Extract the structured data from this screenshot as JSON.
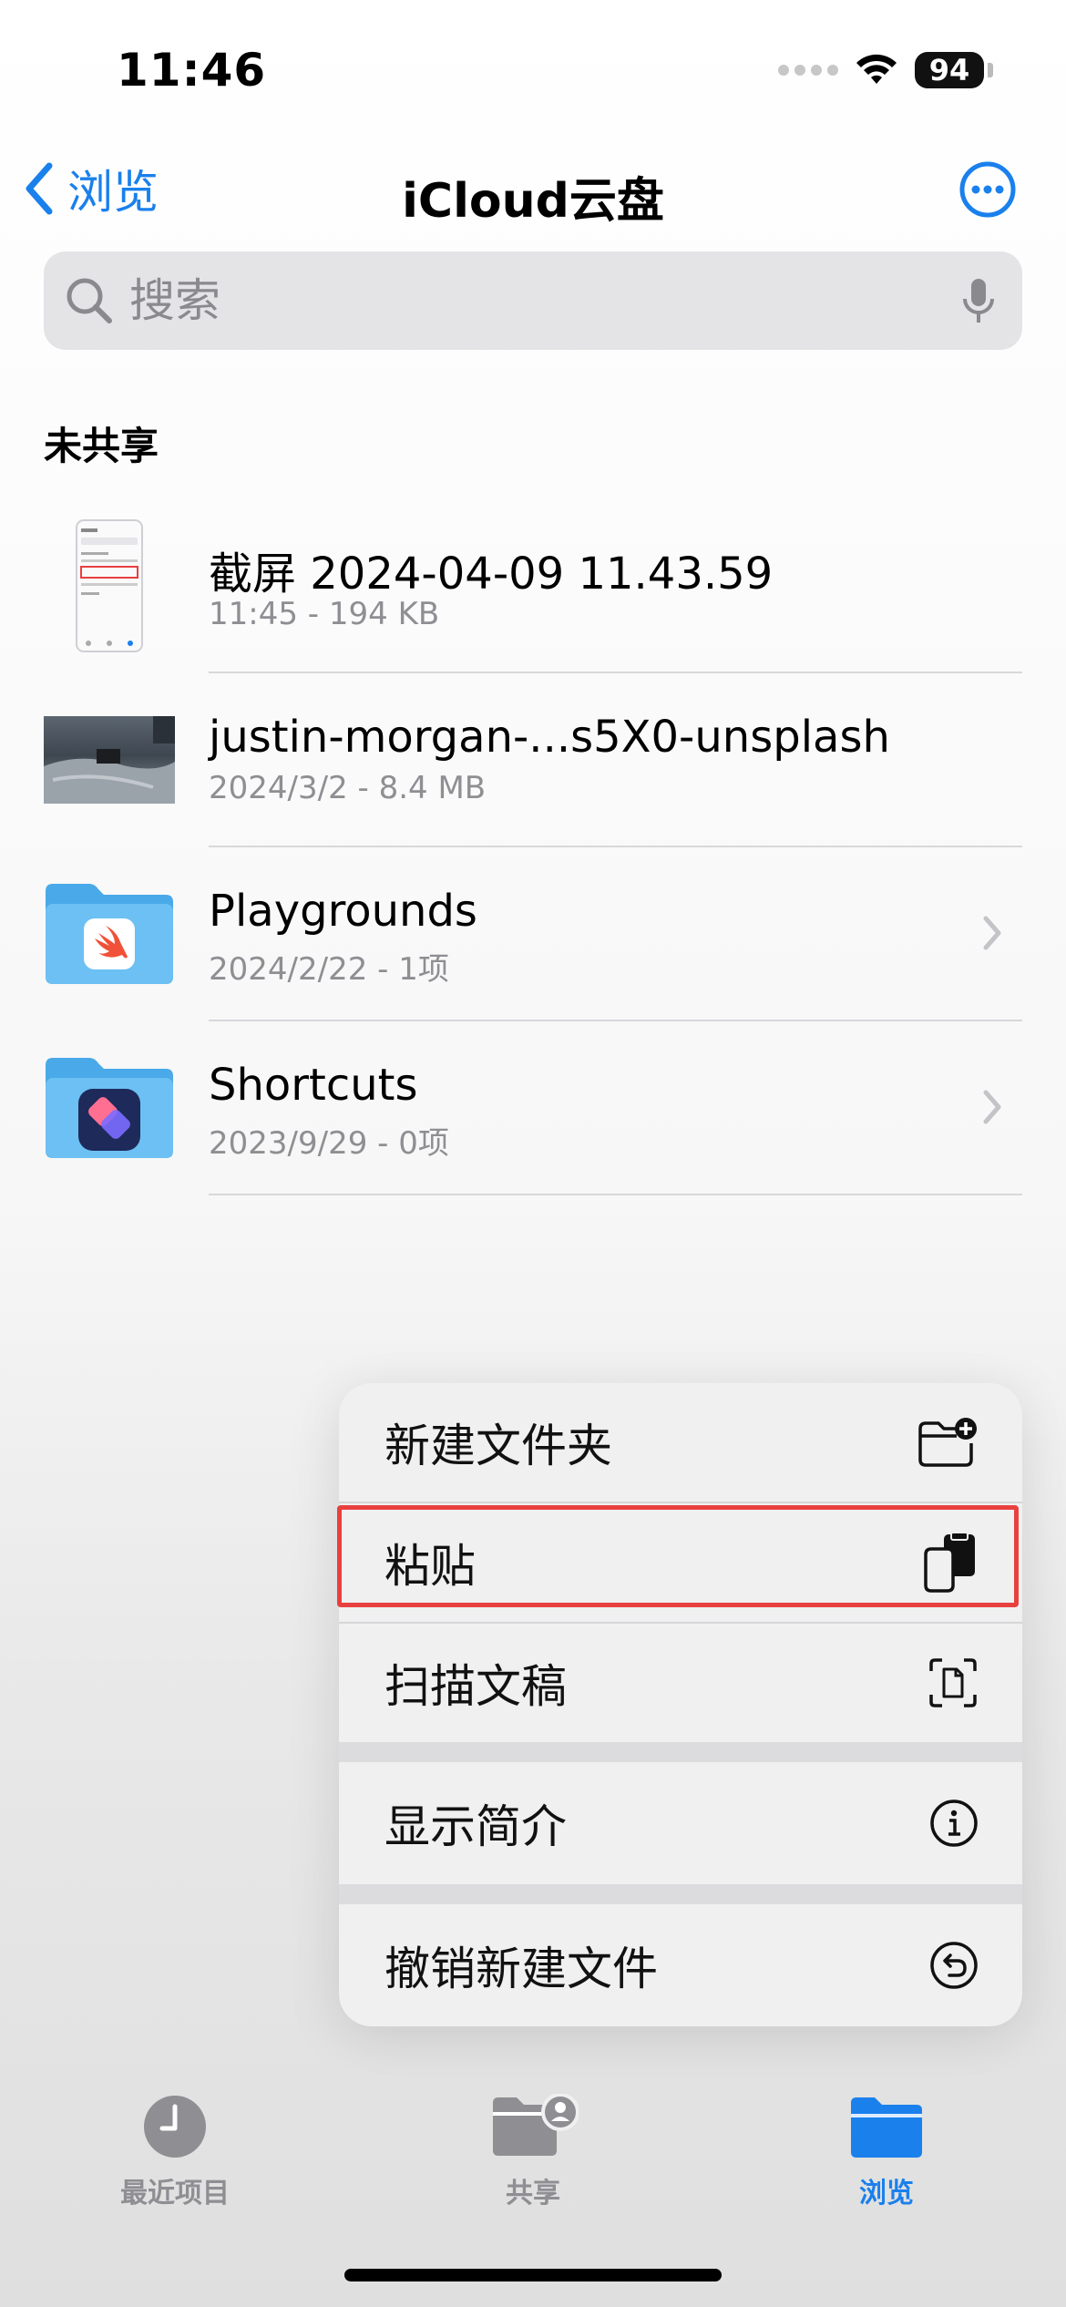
{
  "status_bar": {
    "time": "11:46",
    "battery": "94"
  },
  "nav": {
    "back_label": "浏览",
    "title": "iCloud云盘"
  },
  "search": {
    "placeholder": "搜索"
  },
  "section": {
    "title": "未共享"
  },
  "files": [
    {
      "name": "截屏 2024-04-09 11.43.59",
      "meta": "11:45 - 194 KB",
      "kind": "screenshot"
    },
    {
      "name": "justin-morgan-...s5X0-unsplash",
      "meta": "2024/3/2 - 8.4 MB",
      "kind": "photo"
    },
    {
      "name": "Playgrounds",
      "meta": "2024/2/22 - 1项",
      "kind": "folder",
      "badge": "swift-icon"
    },
    {
      "name": "Shortcuts",
      "meta": "2023/9/29 - 0项",
      "kind": "folder",
      "badge": "shortcuts-icon"
    }
  ],
  "context_menu": {
    "items": [
      {
        "label": "新建文件夹",
        "icon": "new-folder-icon"
      },
      {
        "label": "粘贴",
        "icon": "paste-icon"
      },
      {
        "label": "扫描文稿",
        "icon": "scan-document-icon"
      },
      {
        "label": "显示简介",
        "icon": "info-icon"
      },
      {
        "label": "撤销新建文件",
        "icon": "undo-icon"
      }
    ]
  },
  "tabbar": {
    "tabs": [
      {
        "label": "最近项目",
        "icon": "clock-icon"
      },
      {
        "label": "共享",
        "icon": "shared-folder-icon"
      },
      {
        "label": "浏览",
        "icon": "folder-icon",
        "active": true
      }
    ]
  },
  "colors": {
    "accent": "#1a80ec",
    "highlight": "#e8403f",
    "folder": "#5fb8f0"
  }
}
